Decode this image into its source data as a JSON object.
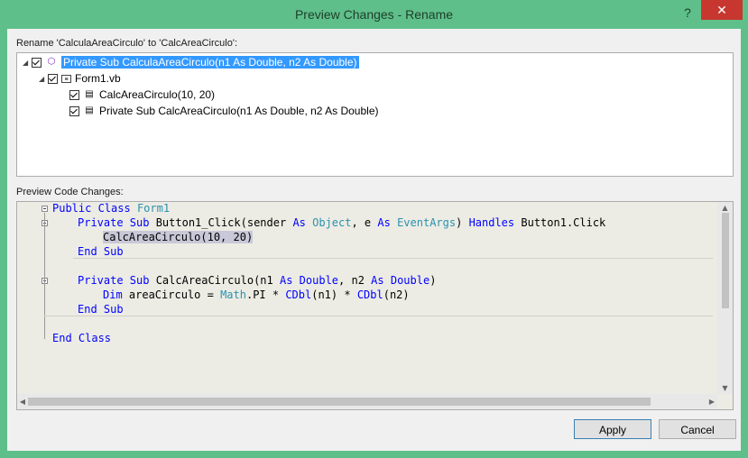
{
  "window": {
    "title": "Preview Changes - Rename",
    "help_label": "?",
    "close_label": "✕"
  },
  "rename_label": "Rename 'CalculaAreaCirculo' to 'CalcAreaCirculo':",
  "tree": [
    {
      "label": "Private Sub CalculaAreaCirculo(n1 As Double, n2 As Double)",
      "icon": "method-icon",
      "selected": true,
      "checked": true
    },
    {
      "label": "Form1.vb",
      "icon": "vb-file-icon",
      "checked": true
    },
    {
      "label": "CalcAreaCirculo(10, 20)",
      "icon": "reference-icon",
      "checked": true
    },
    {
      "label": "Private Sub CalcAreaCirculo(n1 As Double, n2 As Double)",
      "icon": "reference-icon",
      "checked": true
    }
  ],
  "preview_label": "Preview Code Changes:",
  "code": {
    "line1": {
      "kw1": "Public Class",
      "ty1": "Form1"
    },
    "line2": {
      "kw1": "Private Sub",
      "t1": " Button1_Click(sender ",
      "kw2": "As",
      "ty1": "Object",
      "t2": ", e ",
      "kw3": "As",
      "ty2": "EventArgs",
      "t3": ") ",
      "kw4": "Handles",
      "t4": " Button1.Click"
    },
    "line3": {
      "hl": "CalcAreaCirculo(10, 20)"
    },
    "line4": {
      "kw1": "End Sub"
    },
    "line5": {
      "kw1": "Private Sub",
      "t1": " CalcAreaCirculo(n1 ",
      "kw2": "As",
      "kw3": "Double",
      "t2": ", n2 ",
      "kw4": "As",
      "kw5": "Double",
      "t3": ")"
    },
    "line6": {
      "kw1": "Dim",
      "t1": " areaCirculo = ",
      "ty1": "Math",
      "t2": ".PI * ",
      "kw2": "CDbl",
      "t3": "(n1) * ",
      "kw3": "CDbl",
      "t4": "(n2)"
    },
    "line7": {
      "kw1": "End Sub"
    },
    "line8": {
      "kw1": "End Class"
    }
  },
  "buttons": {
    "apply": "Apply",
    "cancel": "Cancel"
  }
}
